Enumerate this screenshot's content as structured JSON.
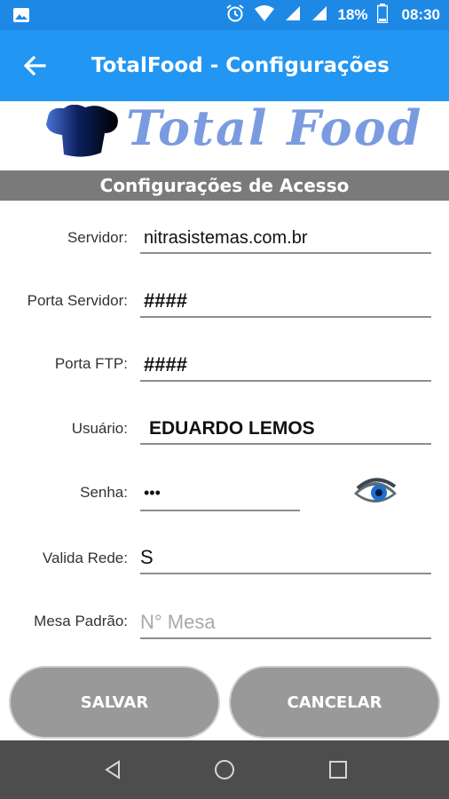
{
  "status_bar": {
    "battery_percent": "18%",
    "time": "08:30",
    "icons": [
      "gallery-icon",
      "alarm-icon",
      "wifi-icon",
      "signal-icon",
      "signal-icon",
      "battery-icon"
    ]
  },
  "app_bar": {
    "title": "TotalFood - Configurações",
    "back_icon": "back-arrow-icon"
  },
  "logo": {
    "wordmark": "Total Food",
    "icon": "chef-hat-icon",
    "colors": {
      "wordmark": "#7b9be0",
      "hat": "#0b1f5c"
    }
  },
  "section": {
    "title": "Configurações de Acesso"
  },
  "form": {
    "servidor": {
      "label": "Servidor:",
      "value": "nitrasistemas.com.br"
    },
    "porta_servidor": {
      "label": "Porta Servidor:",
      "value": "####"
    },
    "porta_ftp": {
      "label": "Porta FTP:",
      "value": "####"
    },
    "usuario": {
      "label": "Usuário:",
      "value": "EDUARDO LEMOS"
    },
    "senha": {
      "label": "Senha:",
      "value": "•••",
      "toggle_icon": "eye-icon"
    },
    "valida_rede": {
      "label": "Valida Rede:",
      "value": "S"
    },
    "mesa_padrao": {
      "label": "Mesa Padrão:",
      "value": "",
      "placeholder": "N° Mesa"
    }
  },
  "buttons": {
    "save": "SALVAR",
    "cancel": "CANCELAR"
  },
  "nav_bar": {
    "icons": [
      "nav-back-icon",
      "nav-home-icon",
      "nav-recents-icon"
    ]
  },
  "colors": {
    "status_bar": "#1e88e5",
    "app_bar": "#2196f3",
    "section_header": "#7a7a7a",
    "button": "#999999",
    "nav_bar": "#4d4d4d"
  }
}
